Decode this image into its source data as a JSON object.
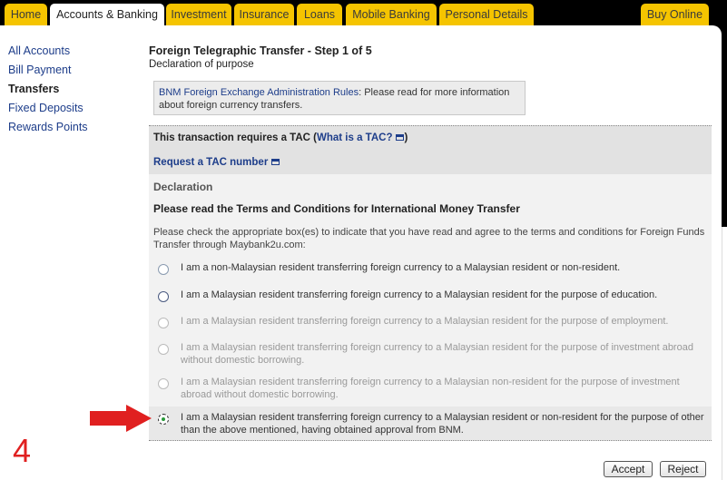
{
  "tabs": [
    {
      "label": "Home"
    },
    {
      "label": "Accounts & Banking",
      "active": true
    },
    {
      "label": "Investment"
    },
    {
      "label": "Insurance"
    },
    {
      "label": "Loans"
    },
    {
      "label": "Mobile Banking"
    },
    {
      "label": "Personal Details"
    }
  ],
  "buy_online": "Buy Online",
  "sidebar": {
    "items": [
      {
        "label": "All Accounts"
      },
      {
        "label": "Bill Payment"
      },
      {
        "label": "Transfers",
        "active": true
      },
      {
        "label": "Fixed Deposits"
      },
      {
        "label": "Rewards Points"
      }
    ]
  },
  "main": {
    "title": "Foreign Telegraphic Transfer - Step 1 of 5",
    "subtitle": "Declaration of purpose",
    "info": {
      "link": "BNM Foreign Exchange Administration Rules",
      "text": ": Please read for more information about foreign currency transfers."
    },
    "tac": {
      "text": "This transaction requires a TAC (",
      "what_link": "What is a TAC?",
      "close": ")",
      "request_link": "Request a TAC number"
    },
    "declaration": {
      "title": "Declaration",
      "heading": "Please read the Terms and Conditions for International Money Transfer",
      "intro": "Please check the appropriate box(es) to indicate that you have read and agree to the terms and conditions for Foreign Funds Transfer through Maybank2u.com:",
      "options": [
        {
          "label": "I am a non-Malaysian resident transferring foreign currency to a Malaysian resident or non-resident.",
          "selected": false
        },
        {
          "label": "I am a Malaysian resident transferring foreign currency to a Malaysian resident for the purpose of education.",
          "selected": false
        },
        {
          "label": "I am a Malaysian resident transferring foreign currency to a Malaysian resident for the purpose of employment.",
          "selected": false
        },
        {
          "label": "I am a Malaysian resident transferring foreign currency to a Malaysian resident for the purpose of investment abroad without domestic borrowing.",
          "selected": false
        },
        {
          "label": "I am a Malaysian resident transferring foreign currency to a Malaysian non-resident for the purpose of investment abroad without domestic borrowing.",
          "selected": false
        },
        {
          "label": "I am a Malaysian resident transferring foreign currency to a Malaysian resident or non-resident for the purpose of other than the above mentioned, having obtained approval from BNM.",
          "selected": true
        }
      ]
    },
    "buttons": {
      "accept": "Accept",
      "reject": "Reject"
    }
  },
  "annotation": {
    "step_number": "4",
    "arrow_color": "#e02020"
  },
  "colors": {
    "tab_bg": "#f5c400",
    "link": "#1d3d8a"
  }
}
